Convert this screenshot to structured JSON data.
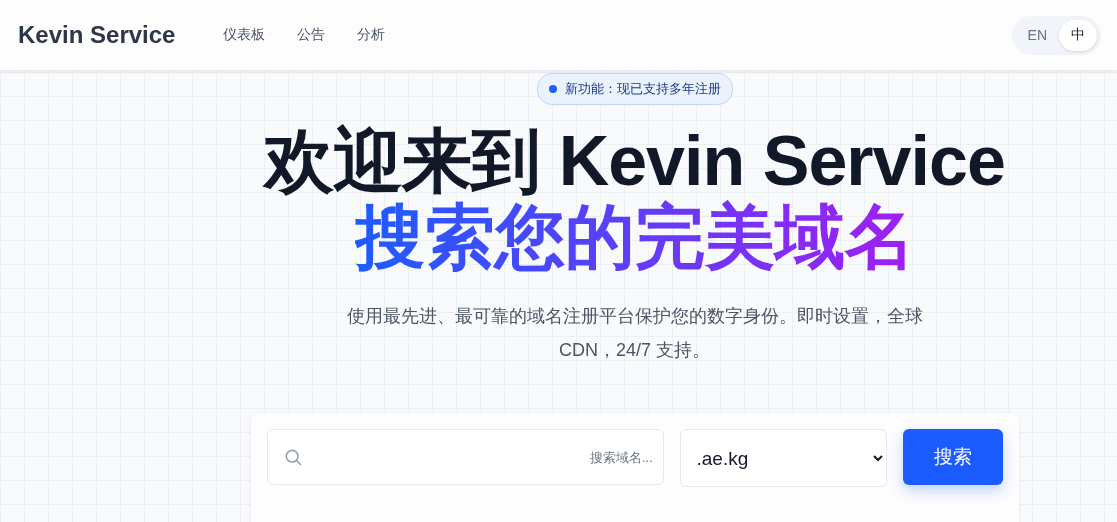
{
  "header": {
    "brand": "Kevin Service",
    "nav": [
      {
        "label": "仪表板"
      },
      {
        "label": "公告"
      },
      {
        "label": "分析"
      }
    ],
    "languages": [
      {
        "label": "EN",
        "selected": false
      },
      {
        "label": "中",
        "selected": true
      }
    ]
  },
  "hero": {
    "badge": "新功能：现已支持多年注册",
    "title": "欢迎来到 Kevin Service",
    "highlight": "搜索您的完美域名",
    "subtitle": "使用最先进、最可靠的域名注册平台保护您的数字身份。即时设置，全球 CDN，24/7 支持。"
  },
  "search": {
    "placeholder": "搜索域名...",
    "suffix": ".ae.kg",
    "button": "搜索"
  }
}
